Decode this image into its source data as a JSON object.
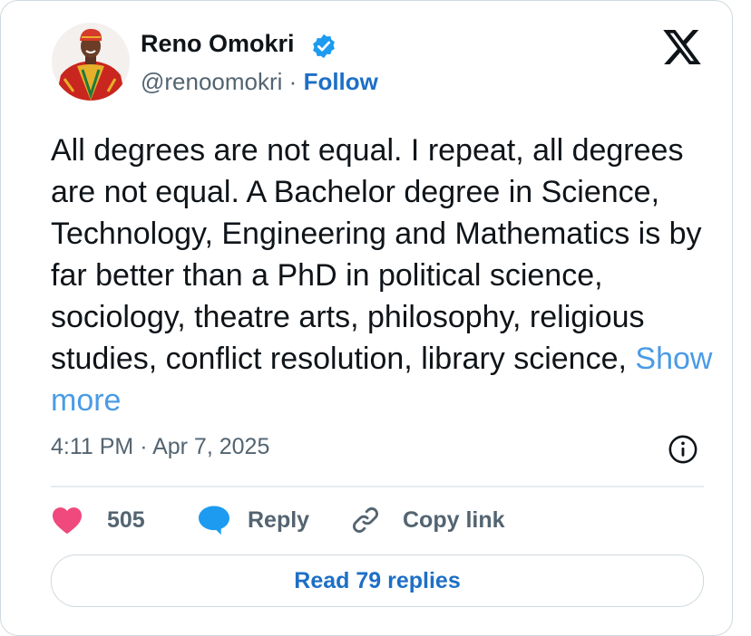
{
  "author": {
    "name": "Reno Omokri",
    "handle": "@renoomokri",
    "separator": " · ",
    "follow_label": "Follow"
  },
  "tweet": {
    "text": "All degrees are not equal. I repeat, all degrees are not equal. A Bachelor degree in Science, Technology, Engineering and Mathematics is by far better than a PhD in political science, sociology, theatre arts, philosophy, religious studies, conflict resolution, library science, ",
    "show_more_label": "Show more",
    "timestamp": "4:11 PM · Apr 7, 2025"
  },
  "actions": {
    "like_count": "505",
    "reply_label": "Reply",
    "copy_label": "Copy link"
  },
  "read_replies_label": "Read 79 replies",
  "colors": {
    "link_blue": "#1d6fc6",
    "show_more_blue": "#4a9be6",
    "heart_pink": "#f0497e",
    "reply_blue": "#1d9bf0",
    "muted": "#536471"
  },
  "icons": [
    "verified-badge-icon",
    "x-logo-icon",
    "info-icon",
    "heart-icon",
    "reply-bubble-icon",
    "link-icon"
  ]
}
